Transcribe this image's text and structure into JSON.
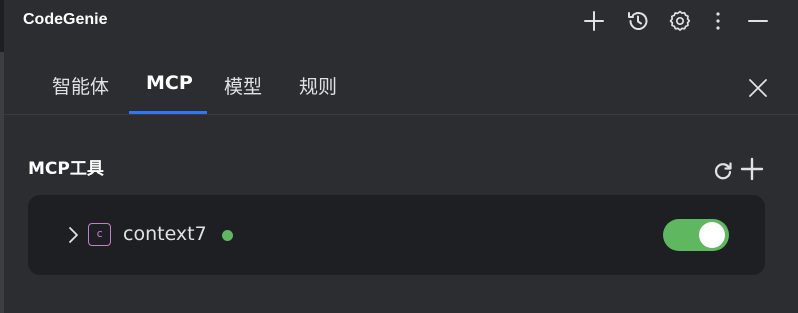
{
  "app": {
    "title": "CodeGenie"
  },
  "titlebar_icons": [
    "plus-icon",
    "history-icon",
    "gear-icon",
    "more-vertical-icon",
    "minimize-icon"
  ],
  "tabs": [
    {
      "label": "智能体",
      "active": false
    },
    {
      "label": "MCP",
      "active": true
    },
    {
      "label": "模型",
      "active": false
    },
    {
      "label": "规则",
      "active": false
    }
  ],
  "section": {
    "title": "MCP工具"
  },
  "tools": [
    {
      "badge": "c",
      "name": "context7",
      "status": "connected",
      "enabled": true
    }
  ],
  "colors": {
    "background": "#2b2d30",
    "card": "#1e1f22",
    "accent": "#3574f0",
    "status_ok": "#5fb85f",
    "badge": "#c77dcf"
  }
}
